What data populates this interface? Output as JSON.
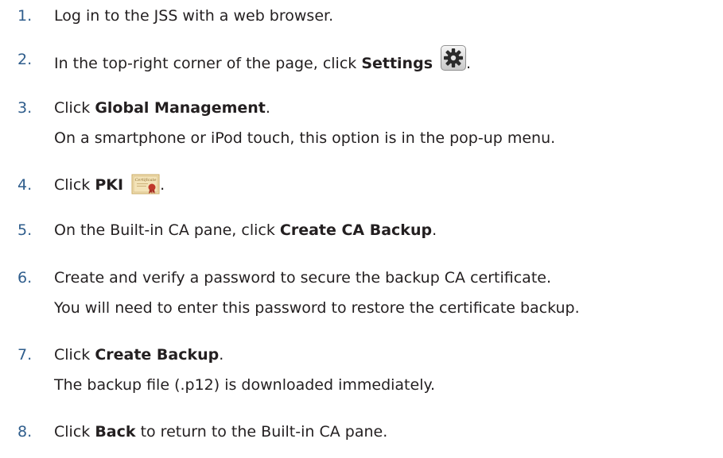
{
  "steps": [
    {
      "num": "1.",
      "pre": "Log in to the JSS with a web browser.",
      "bold": "",
      "post": "",
      "note": ""
    },
    {
      "num": "2.",
      "pre": "In the top-right corner of the page, click ",
      "bold": "Settings",
      "post": ".",
      "icon": "gear-icon",
      "note": ""
    },
    {
      "num": "3.",
      "pre": "Click ",
      "bold": "Global Management",
      "post": ".",
      "note": "On a smartphone or iPod touch, this option is in the pop-up menu."
    },
    {
      "num": "4.",
      "pre": "Click ",
      "bold": "PKI",
      "post": ".",
      "icon": "certificate-icon",
      "icon_text": "Certificate",
      "note": ""
    },
    {
      "num": "5.",
      "pre": "On the Built-in CA pane, click ",
      "bold": "Create CA Backup",
      "post": ".",
      "note": ""
    },
    {
      "num": "6.",
      "pre": "Create and verify a password to secure the backup CA certificate.",
      "bold": "",
      "post": "",
      "note": "You will need to enter this password to restore the certificate backup."
    },
    {
      "num": "7.",
      "pre": "Click ",
      "bold": "Create Backup",
      "post": ".",
      "note": "The backup file (.p12) is downloaded immediately."
    },
    {
      "num": "8.",
      "pre": "Click ",
      "bold": "Back",
      "post": " to return to the Built-in CA pane.",
      "note": ""
    }
  ],
  "colors": {
    "number": "#2f5d8c",
    "text": "#231f20"
  }
}
